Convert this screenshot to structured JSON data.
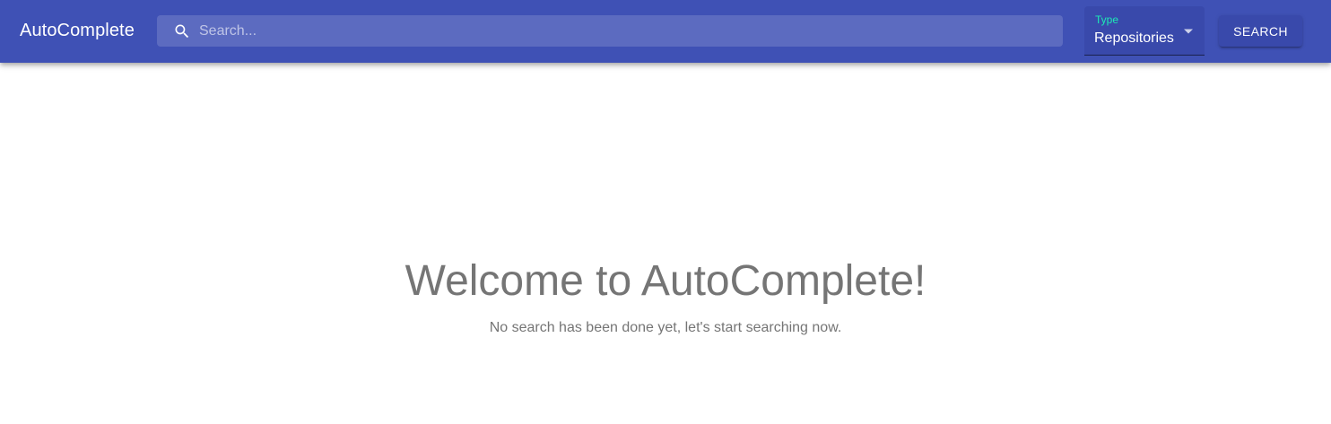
{
  "header": {
    "title": "AutoComplete",
    "search": {
      "placeholder": "Search...",
      "value": "",
      "icon": "search-icon"
    },
    "type_select": {
      "label": "Type",
      "value": "Repositories",
      "icon": "arrow-drop-down-icon"
    },
    "search_button_label": "SEARCH"
  },
  "main": {
    "title": "Welcome to AutoComplete!",
    "subtitle": "No search has been done yet, let's start searching now."
  },
  "colors": {
    "appbar": "#3f51b5",
    "search_box": "#5c6bc0",
    "select_label_accent": "#1de9b6",
    "button": "#3949ab",
    "welcome_text": "#757575"
  }
}
